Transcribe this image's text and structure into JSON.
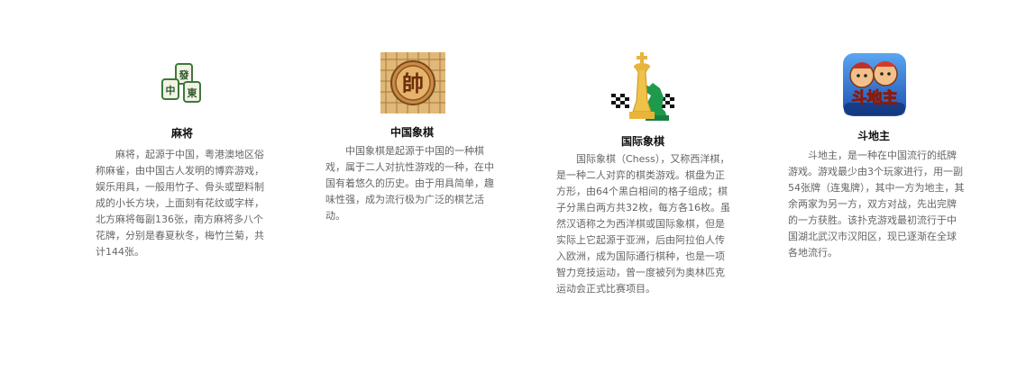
{
  "cards": [
    {
      "icon": "mahjong-tiles-icon",
      "tile_chars": [
        "發",
        "中",
        "東"
      ],
      "title": "麻将",
      "description": "麻将，起源于中国，粤港澳地区俗称麻雀，由中国古人发明的博弈游戏，娱乐用具，一般用竹子、骨头或塑料制成的小长方块，上面刻有花纹或字样，北方麻将每副136张，南方麻将多八个花牌，分别是春夏秋冬，梅竹兰菊，共计144张。"
    },
    {
      "icon": "chinese-chess-icon",
      "piece_char": "帥",
      "title": "中国象棋",
      "description": "中国象棋是起源于中国的一种棋戏，属于二人对抗性游戏的一种，在中国有着悠久的历史。由于用具简单，趣味性强，成为流行极为广泛的棋艺活动。"
    },
    {
      "icon": "chess-pieces-icon",
      "title": "国际象棋",
      "description": "国际象棋（Chess），又称西洋棋，是一种二人对弈的棋类游戏。棋盘为正方形，由64个黑白相间的格子组成；棋子分黑白两方共32枚，每方各16枚。虽然汉语称之为西洋棋或国际象棋，但是实际上它起源于亚洲，后由阿拉伯人传入欧洲，成为国际通行棋种，也是一项智力竞技运动，曾一度被列为奥林匹克运动会正式比赛项目。"
    },
    {
      "icon": "doudizhu-app-icon",
      "logo_text": "斗地主",
      "title": "斗地主",
      "description": "斗地主，是一种在中国流行的纸牌游戏。游戏最少由3个玩家进行，用一副54张牌（连鬼牌），其中一方为地主，其余两家为另一方，双方对战，先出完牌的一方获胜。该扑克游戏最初流行于中国湖北武汉市汉阳区，现已逐渐在全球各地流行。"
    }
  ],
  "colors": {
    "title": "#111111",
    "text": "#666666",
    "mahjong_green": "#3c7a3a",
    "chess_board": "#e0b877",
    "chess_gold": "#e8b53a",
    "chess_green": "#1f9a4c",
    "ddz_blue": "#2a6fd6"
  }
}
